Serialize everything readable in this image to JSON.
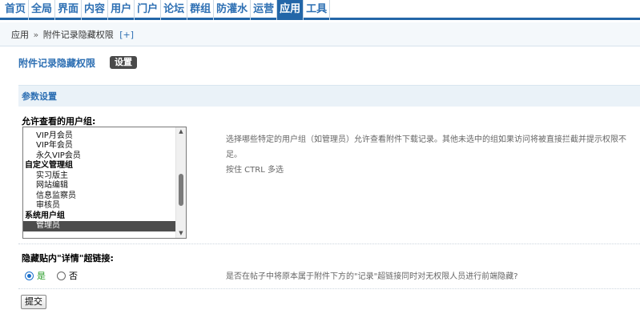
{
  "nav": {
    "items": [
      {
        "label": "首页"
      },
      {
        "label": "全局"
      },
      {
        "label": "界面"
      },
      {
        "label": "内容"
      },
      {
        "label": "用户"
      },
      {
        "label": "门户"
      },
      {
        "label": "论坛"
      },
      {
        "label": "群组"
      },
      {
        "label": "防灌水"
      },
      {
        "label": "运营"
      },
      {
        "label": "应用"
      },
      {
        "label": "工具"
      }
    ],
    "active_index": 10,
    "accent_color": "#2366a8"
  },
  "breadcrumb": {
    "root": "应用",
    "separator": "»",
    "current": "附件记录隐藏权限",
    "add": "[+]"
  },
  "page": {
    "title": "附件记录隐藏权限",
    "setting_button": "设置"
  },
  "section": {
    "title": "参数设置"
  },
  "user_groups": {
    "label": "允许查看的用户组:",
    "options": [
      {
        "text": "VIP月会员",
        "type": "option"
      },
      {
        "text": "VIP年会员",
        "type": "option"
      },
      {
        "text": "永久VIP会员",
        "type": "option"
      },
      {
        "text": "自定义管理组",
        "type": "group"
      },
      {
        "text": "实习版主",
        "type": "option"
      },
      {
        "text": "网站编辑",
        "type": "option"
      },
      {
        "text": "信息监察员",
        "type": "option"
      },
      {
        "text": "审核员",
        "type": "option"
      },
      {
        "text": "系统用户组",
        "type": "group"
      },
      {
        "text": "管理员",
        "type": "option",
        "selected": true
      }
    ],
    "hint_line1": "选择哪些特定的用户组（如管理员）允许查看附件下载记录。其他未选中的组如果访问将被直接拦截并提示权限不足。",
    "hint_line2": "按住 CTRL 多选"
  },
  "hide_link": {
    "label": "隐藏贴内\"详情\"超链接:",
    "yes_label": "是",
    "no_label": "否",
    "selected": "yes",
    "hint": "是否在帖子中将原本属于附件下方的\"记录\"超链接同时对无权限人员进行前端隐藏?"
  },
  "submit": {
    "label": "提交"
  }
}
